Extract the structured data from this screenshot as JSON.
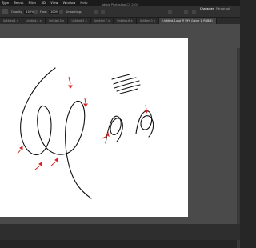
{
  "menubar": {
    "items": [
      "Type",
      "Select",
      "Filter",
      "3D",
      "View",
      "Window",
      "Help"
    ],
    "title": "Adobe Photoshop CC 2019"
  },
  "options": {
    "opacity_label": "Opacity:",
    "opacity_value": "100%",
    "flow_label": "Flow:",
    "flow_value": "100%",
    "smoothing_label": "Smoothing:"
  },
  "panels": {
    "tabs": [
      "Character",
      "Paragraph"
    ]
  },
  "document_tabs": [
    "Untitled-1 ×",
    "Untitled-4 ×",
    "Untitled-5 ×",
    "Untitled-5 ×",
    "Untitled-7 ×",
    "Untitled-6 ×",
    "Untitled-3 ×",
    "Untitled-3.psd @ 59% (Layer 1, RGB/8)"
  ],
  "colors": {
    "annotation": "#d82020",
    "stroke": "#111111",
    "canvas": "#ffffff",
    "workspace": "#4a4a4a"
  }
}
